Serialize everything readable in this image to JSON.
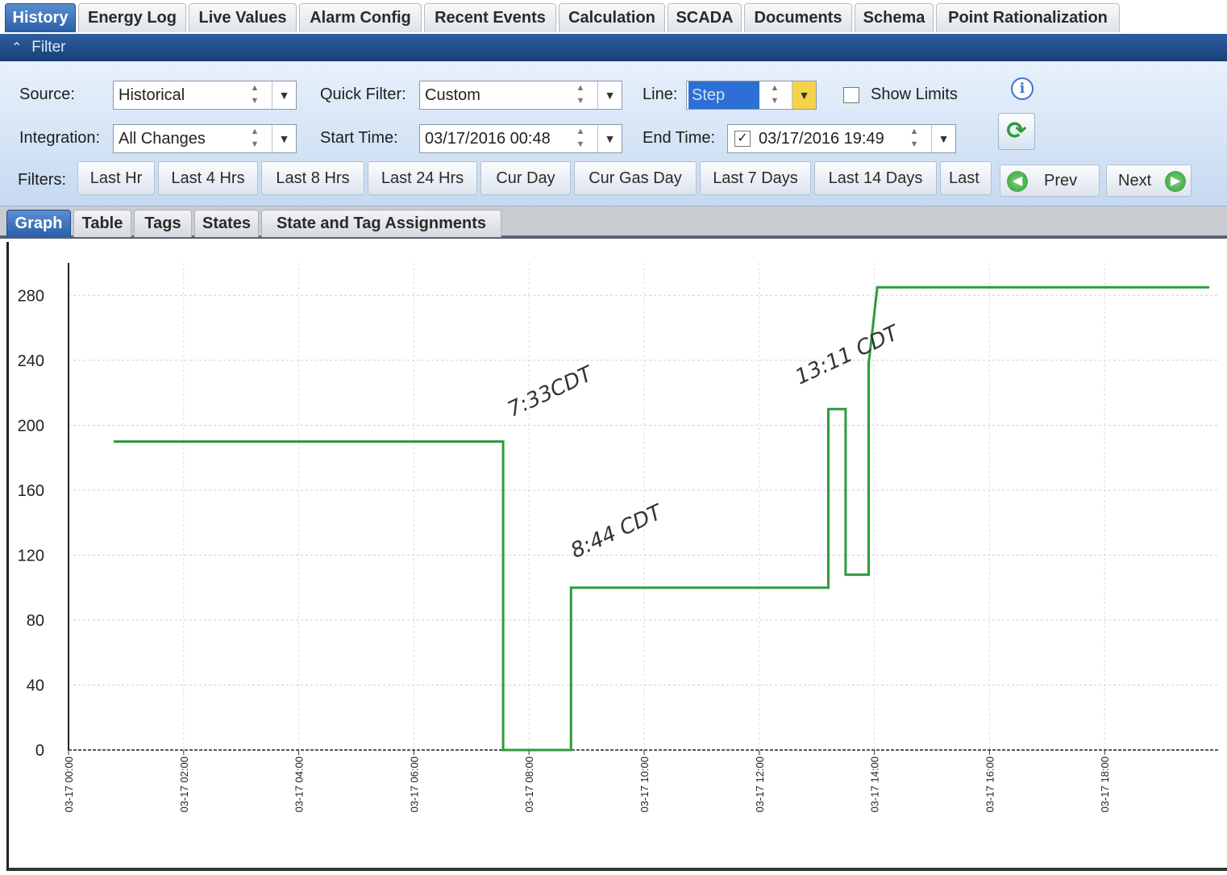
{
  "top_tabs": [
    {
      "label": "History",
      "active": true
    },
    {
      "label": "Energy Log"
    },
    {
      "label": "Live Values"
    },
    {
      "label": "Alarm Config"
    },
    {
      "label": "Recent Events"
    },
    {
      "label": "Calculation"
    },
    {
      "label": "SCADA"
    },
    {
      "label": "Documents"
    },
    {
      "label": "Schema"
    },
    {
      "label": "Point Rationalization"
    }
  ],
  "filter": {
    "header": "Filter",
    "source_label": "Source:",
    "source_value": "Historical",
    "quick_filter_label": "Quick Filter:",
    "quick_filter_value": "Custom",
    "line_label": "Line:",
    "line_value": "Step",
    "show_limits_label": "Show Limits",
    "show_limits_checked": false,
    "integration_label": "Integration:",
    "integration_value": "All Changes",
    "start_time_label": "Start Time:",
    "start_time_value": "03/17/2016 00:48",
    "end_time_label": "End Time:",
    "end_time_checked": true,
    "end_time_value": "03/17/2016 19:49",
    "filters_label": "Filters:",
    "quick_buttons": [
      "Last Hr",
      "Last 4 Hrs",
      "Last 8 Hrs",
      "Last 24 Hrs",
      "Cur Day",
      "Cur Gas Day",
      "Last 7 Days",
      "Last 14 Days",
      "Last"
    ],
    "prev_label": "Prev",
    "next_label": "Next"
  },
  "sub_tabs": [
    {
      "label": "Graph",
      "active": true
    },
    {
      "label": "Table"
    },
    {
      "label": "Tags"
    },
    {
      "label": "States"
    },
    {
      "label": "State and Tag Assignments"
    }
  ],
  "icons": {
    "collapse": "chevron-up-icon",
    "info": "info-icon",
    "refresh": "refresh-icon",
    "prev": "arrow-left-icon",
    "next": "arrow-right-icon"
  },
  "colors": {
    "series": "#2f9a3f",
    "active_tab": "#2a5ea8",
    "filter_header": "#173f78"
  },
  "chart_data": {
    "type": "line",
    "step": true,
    "ylim": [
      0,
      300
    ],
    "yticks": [
      0,
      40,
      80,
      120,
      160,
      200,
      240,
      280
    ],
    "x_range_hours": [
      0,
      20
    ],
    "xticks": [
      {
        "hour": 0,
        "label": "03-17 00:00"
      },
      {
        "hour": 2,
        "label": "03-17 02:00"
      },
      {
        "hour": 4,
        "label": "03-17 04:00"
      },
      {
        "hour": 6,
        "label": "03-17 06:00"
      },
      {
        "hour": 8,
        "label": "03-17 08:00"
      },
      {
        "hour": 10,
        "label": "03-17 10:00"
      },
      {
        "hour": 12,
        "label": "03-17 12:00"
      },
      {
        "hour": 14,
        "label": "03-17 14:00"
      },
      {
        "hour": 16,
        "label": "03-17 16:00"
      },
      {
        "hour": 18,
        "label": "03-17 18:00"
      }
    ],
    "grid": true,
    "series": [
      {
        "points": [
          {
            "x": 0.8,
            "y": 190
          },
          {
            "x": 7.55,
            "y": 190
          },
          {
            "x": 7.55,
            "y": 0
          },
          {
            "x": 8.73,
            "y": 0
          },
          {
            "x": 8.73,
            "y": 100
          },
          {
            "x": 13.2,
            "y": 100
          },
          {
            "x": 13.2,
            "y": 210
          },
          {
            "x": 13.5,
            "y": 210
          },
          {
            "x": 13.5,
            "y": 108
          },
          {
            "x": 13.9,
            "y": 108
          },
          {
            "x": 13.9,
            "y": 238
          },
          {
            "x": 14.05,
            "y": 285
          },
          {
            "x": 19.8,
            "y": 285
          }
        ]
      }
    ],
    "annotations": [
      {
        "text": "7:33CDT",
        "x": 7.7,
        "y": 205
      },
      {
        "text": "8:44 CDT",
        "x": 8.8,
        "y": 118
      },
      {
        "text": "13:11 CDT",
        "x": 12.7,
        "y": 225
      }
    ]
  }
}
